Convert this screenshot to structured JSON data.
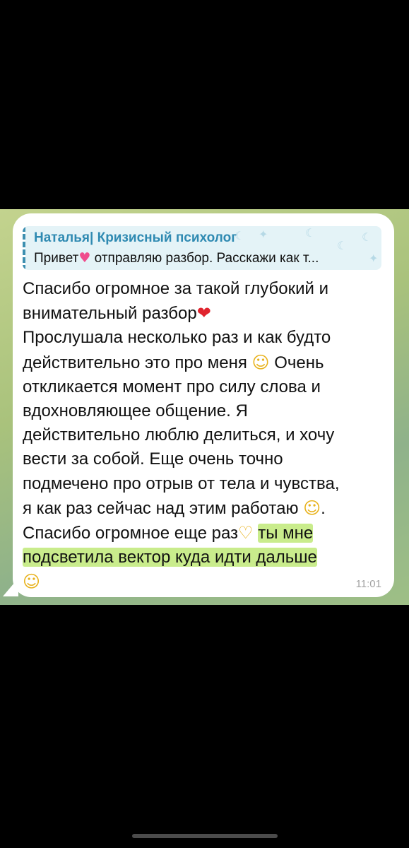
{
  "reply": {
    "sender": "Наталья| Кризисный психолог",
    "text_before_icon": "Привет",
    "icon": "growing-heart-icon",
    "text_after_icon": " отправляю разбор. Расскажи как т..."
  },
  "message": {
    "lines": [
      "Спасибо огромное за такой глубокий и",
      "внимательный разбор",
      "Прослушала несколько раз и как будто",
      "действительно это про меня",
      " Очень",
      "откликается момент про силу слова и",
      "вдохновляющее общение. Я",
      "действительно люблю делиться, и хочу",
      "вести за собой. Еще очень точно",
      "подмечено про отрыв от тела и чувства,",
      "я как раз сейчас над этим работаю",
      ".",
      "Спасибо огромное еще раз",
      "ты мне",
      "подсветила вектор куда идти дальше"
    ],
    "emojis": {
      "heart": "❤",
      "relieved": "☺",
      "smile": "☺",
      "heart_hands": "♡",
      "hug": "☺"
    },
    "highlight_color": "#c9ec8c"
  },
  "time": "11:01",
  "colors": {
    "sender": "#2f8ab2",
    "reply_bg": "#e4f3f7",
    "bubble": "#ffffff"
  }
}
